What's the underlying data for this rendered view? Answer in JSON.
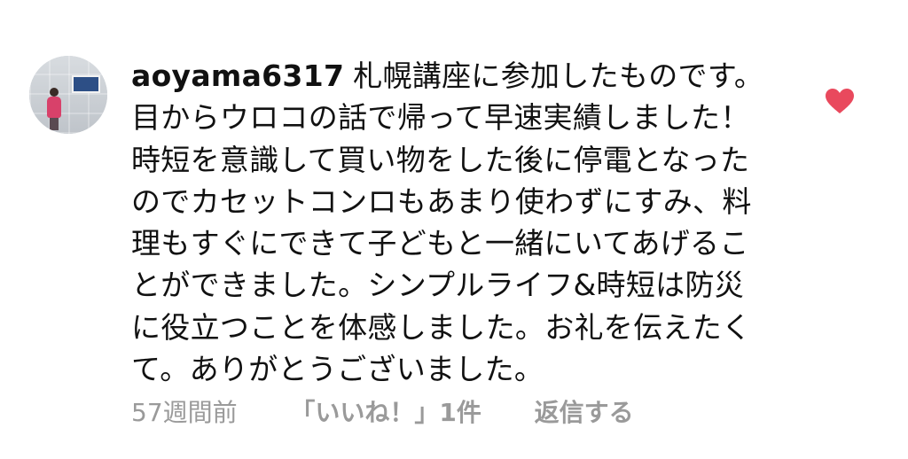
{
  "comment": {
    "username": "aoyama6317",
    "text": "札幌講座に参加したものです。目からウロコの話で帰って早速実績しました！時短を意識して買い物をした後に停電となったのでカセットコンロもあまり使わずにすみ、料理もすぐにできて子どもと一緒にいてあげることができました。シンプルライフ&時短は防災に役立つことを体感しました。お礼を伝えたくて。ありがとうございました。",
    "time": "57週間前",
    "likes": "「いいね！」1件",
    "reply": "返信する",
    "liked": true,
    "heart_icon": "heart-icon"
  },
  "colors": {
    "heart": "#e9495d",
    "meta_text": "#9a9a9a",
    "body_text": "#111111"
  }
}
